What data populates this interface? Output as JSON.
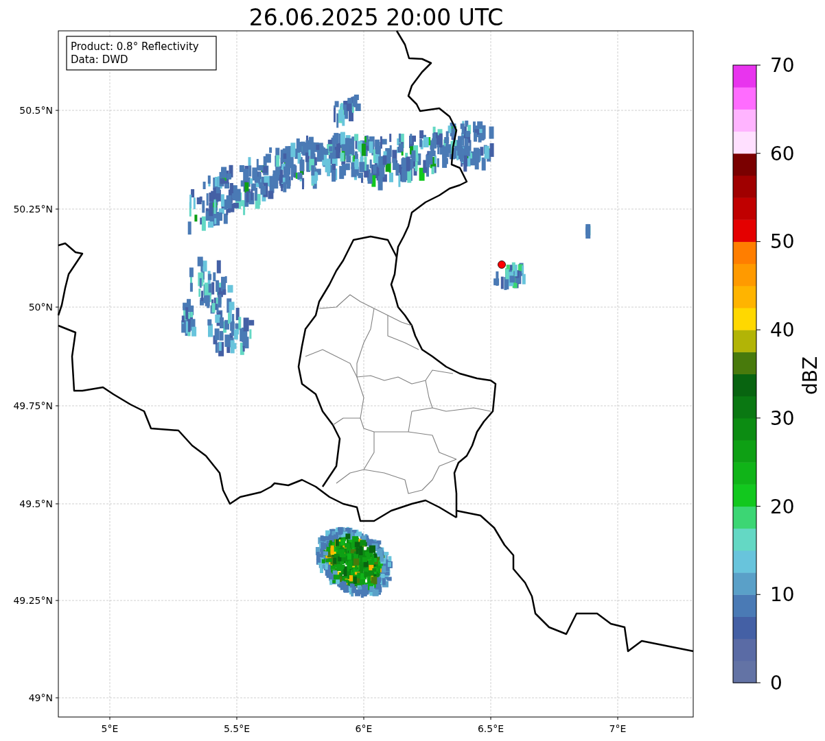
{
  "title": "26.06.2025 20:00 UTC",
  "info_box": [
    "Product: 0.8° Reflectivity",
    "Data: DWD"
  ],
  "y_ticks": [
    "50.5°N",
    "50.25°N",
    "50°N",
    "49.75°N",
    "49.5°N",
    "49.25°N",
    "49°N"
  ],
  "x_ticks": [
    "5°E",
    "5.5°E",
    "6°E",
    "6.5°E",
    "7°E"
  ],
  "colorbar": {
    "label": "dBZ",
    "ticks": [
      "70",
      "60",
      "50",
      "40",
      "30",
      "20",
      "10",
      "0"
    ],
    "bins": [
      {
        "color": "#6373a5"
      },
      {
        "color": "#5a6ba5"
      },
      {
        "color": "#4460a5"
      },
      {
        "color": "#4a7ab5"
      },
      {
        "color": "#5aa0c8"
      },
      {
        "color": "#68c4dc"
      },
      {
        "color": "#64d8c4"
      },
      {
        "color": "#3cd674"
      },
      {
        "color": "#12c81e"
      },
      {
        "color": "#10b418"
      },
      {
        "color": "#0ea014"
      },
      {
        "color": "#0c8c12"
      },
      {
        "color": "#0a7812"
      },
      {
        "color": "#086410"
      },
      {
        "color": "#487a0c"
      },
      {
        "color": "#b2b406"
      },
      {
        "color": "#ffd800"
      },
      {
        "color": "#ffb400"
      },
      {
        "color": "#ff9a00"
      },
      {
        "color": "#ff7e00"
      },
      {
        "color": "#e40000"
      },
      {
        "color": "#c00000"
      },
      {
        "color": "#a00000"
      },
      {
        "color": "#7a0000"
      },
      {
        "color": "#ffe0ff"
      },
      {
        "color": "#ffb4ff"
      },
      {
        "color": "#ff6cff"
      },
      {
        "color": "#e834ee"
      }
    ]
  }
}
